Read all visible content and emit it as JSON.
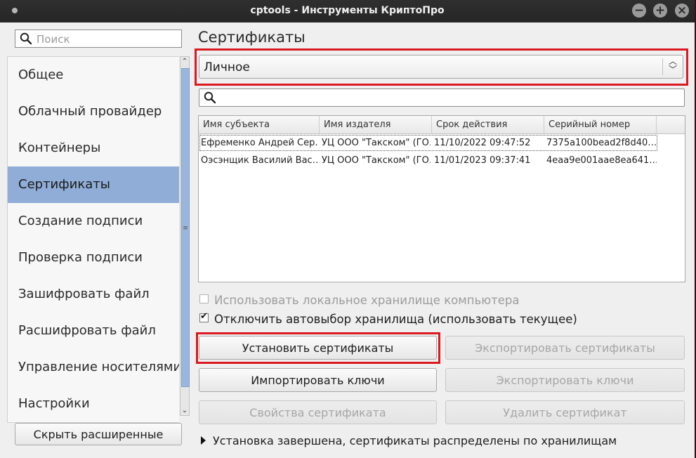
{
  "window": {
    "title": "cptools - Инструменты КриптоПро"
  },
  "sidebar": {
    "search_placeholder": "Поиск",
    "items": [
      {
        "label": "Общее"
      },
      {
        "label": "Облачный провайдер"
      },
      {
        "label": "Контейнеры"
      },
      {
        "label": "Сертификаты",
        "active": true
      },
      {
        "label": "Создание подписи"
      },
      {
        "label": "Проверка подписи"
      },
      {
        "label": "Зашифровать файл"
      },
      {
        "label": "Расшифровать файл"
      },
      {
        "label": "Управление носителями"
      },
      {
        "label": "Настройки"
      }
    ],
    "hide_button": "Скрыть расширенные"
  },
  "main": {
    "title": "Сертификаты",
    "store_select": {
      "value": "Личное"
    },
    "filter": {
      "value": ""
    },
    "table": {
      "columns": [
        "Имя субъекта",
        "Имя издателя",
        "Срок действия",
        "Серийный номер"
      ],
      "rows": [
        [
          "Ефременко Андрей Сер…",
          "УЦ ООО \"Такском\" (ГО…",
          "11/10/2022 09:47:52",
          "7375a100bead2f8d40…"
        ],
        [
          "Оэсэнщик Василий Вас…",
          "УЦ ООО \"Такском\" (ГО…",
          "11/01/2023 09:37:41",
          "4eaa9e001aae8ea641…"
        ]
      ]
    },
    "options": {
      "use_local_store": {
        "label": "Использовать локальное хранилище компьютера",
        "checked": false,
        "enabled": false
      },
      "disable_autoselect": {
        "label": "Отключить автовыбор хранилища (использовать текущее)",
        "checked": true,
        "enabled": true
      }
    },
    "buttons": {
      "install": "Установить сертификаты",
      "export_certs": "Экспортировать сертификаты",
      "import_keys": "Импортировать ключи",
      "export_keys": "Экспортировать ключи",
      "cert_props": "Свойства сертификата",
      "delete_cert": "Удалить сертификат"
    },
    "status": "Установка завершена, сертификаты распределены по хранилищам"
  },
  "colors": {
    "highlight_box": "#d91a21",
    "selection": "#8fadd6",
    "titlebar": "#2b2b2b"
  },
  "icons": [
    "menu-dot-icon",
    "minimize-icon",
    "maximize-icon",
    "close-icon",
    "search-icon",
    "spin-arrows-icon",
    "disclosure-triangle-icon"
  ]
}
